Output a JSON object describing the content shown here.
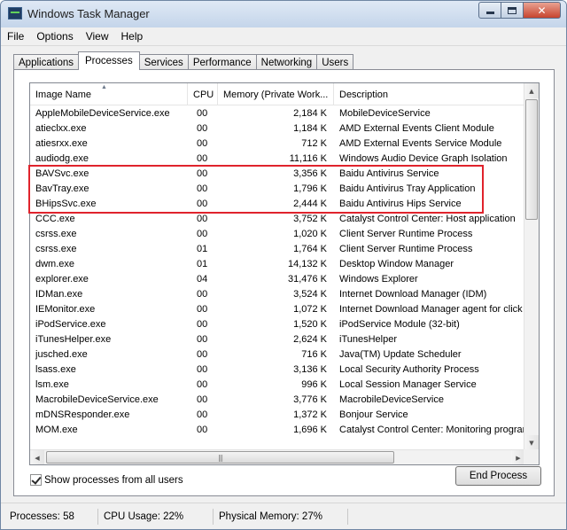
{
  "window": {
    "title": "Windows Task Manager"
  },
  "menu": [
    "File",
    "Options",
    "View",
    "Help"
  ],
  "tabs": [
    "Applications",
    "Processes",
    "Services",
    "Performance",
    "Networking",
    "Users"
  ],
  "active_tab": "Processes",
  "columns": {
    "name": "Image Name",
    "cpu": "CPU",
    "memory": "Memory (Private Work...",
    "description": "Description"
  },
  "processes": [
    {
      "name": "AppleMobileDeviceService.exe",
      "cpu": "00",
      "mem": "2,184 K",
      "desc": "MobileDeviceService"
    },
    {
      "name": "atieclxx.exe",
      "cpu": "00",
      "mem": "1,184 K",
      "desc": "AMD External Events Client Module"
    },
    {
      "name": "atiesrxx.exe",
      "cpu": "00",
      "mem": "712 K",
      "desc": "AMD External Events Service Module"
    },
    {
      "name": "audiodg.exe",
      "cpu": "00",
      "mem": "11,116 K",
      "desc": "Windows Audio Device Graph Isolation"
    },
    {
      "name": "BAVSvc.exe",
      "cpu": "00",
      "mem": "3,356 K",
      "desc": "Baidu Antivirus Service"
    },
    {
      "name": "BavTray.exe",
      "cpu": "00",
      "mem": "1,796 K",
      "desc": "Baidu Antivirus Tray Application"
    },
    {
      "name": "BHipsSvc.exe",
      "cpu": "00",
      "mem": "2,444 K",
      "desc": "Baidu Antivirus Hips Service"
    },
    {
      "name": "CCC.exe",
      "cpu": "00",
      "mem": "3,752 K",
      "desc": "Catalyst Control Center: Host application"
    },
    {
      "name": "csrss.exe",
      "cpu": "00",
      "mem": "1,020 K",
      "desc": "Client Server Runtime Process"
    },
    {
      "name": "csrss.exe",
      "cpu": "01",
      "mem": "1,764 K",
      "desc": "Client Server Runtime Process"
    },
    {
      "name": "dwm.exe",
      "cpu": "01",
      "mem": "14,132 K",
      "desc": "Desktop Window Manager"
    },
    {
      "name": "explorer.exe",
      "cpu": "04",
      "mem": "31,476 K",
      "desc": "Windows Explorer"
    },
    {
      "name": "IDMan.exe",
      "cpu": "00",
      "mem": "3,524 K",
      "desc": "Internet Download Manager (IDM)"
    },
    {
      "name": "IEMonitor.exe",
      "cpu": "00",
      "mem": "1,072 K",
      "desc": "Internet Download Manager agent for click m"
    },
    {
      "name": "iPodService.exe",
      "cpu": "00",
      "mem": "1,520 K",
      "desc": "iPodService Module (32-bit)"
    },
    {
      "name": "iTunesHelper.exe",
      "cpu": "00",
      "mem": "2,624 K",
      "desc": "iTunesHelper"
    },
    {
      "name": "jusched.exe",
      "cpu": "00",
      "mem": "716 K",
      "desc": "Java(TM) Update Scheduler"
    },
    {
      "name": "lsass.exe",
      "cpu": "00",
      "mem": "3,136 K",
      "desc": "Local Security Authority Process"
    },
    {
      "name": "lsm.exe",
      "cpu": "00",
      "mem": "996 K",
      "desc": "Local Session Manager Service"
    },
    {
      "name": "MacrobileDeviceService.exe",
      "cpu": "00",
      "mem": "3,776 K",
      "desc": "MacrobileDeviceService"
    },
    {
      "name": "mDNSResponder.exe",
      "cpu": "00",
      "mem": "1,372 K",
      "desc": "Bonjour Service"
    },
    {
      "name": "MOM.exe",
      "cpu": "00",
      "mem": "1,696 K",
      "desc": "Catalyst Control Center: Monitoring program"
    }
  ],
  "highlighted_rows": [
    4,
    5,
    6
  ],
  "highlight_color": "#e0232c",
  "show_all_users": {
    "label": "Show processes from all users",
    "checked": true
  },
  "end_process_label": "End Process",
  "status": {
    "processes": "Processes: 58",
    "cpu": "CPU Usage: 22%",
    "memory": "Physical Memory: 27%"
  }
}
